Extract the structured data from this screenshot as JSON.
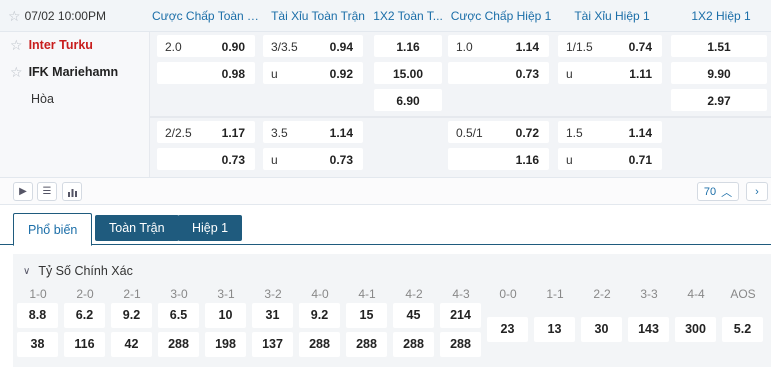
{
  "match": {
    "datetime": "07/02 10:00PM",
    "home": "Inter Turku",
    "away": "IFK Mariehamn",
    "draw": "Hòa"
  },
  "columns": [
    "Cược Chấp Toàn T...",
    "Tài Xỉu Toàn Trận",
    "1X2 Toàn T...",
    "Cược Chấp Hiệp 1",
    "Tài Xỉu Hiệp 1",
    "1X2 Hiệp 1"
  ],
  "odds": {
    "row1": {
      "ah_ft": {
        "line": "2.0",
        "home": "0.90",
        "away": "0.98"
      },
      "ou_ft": {
        "line": "3/3.5",
        "over": "0.94",
        "u": "u",
        "under": "0.92"
      },
      "x12_ft": {
        "home": "1.16",
        "away": "15.00",
        "draw": "6.90"
      },
      "ah_h1": {
        "line": "1.0",
        "home": "1.14",
        "away": "0.73"
      },
      "ou_h1": {
        "line": "1/1.5",
        "over": "0.74",
        "u": "u",
        "under": "1.11"
      },
      "x12_h1": {
        "home": "1.51",
        "away": "9.90",
        "draw": "2.97"
      }
    },
    "row2": {
      "ah_ft": {
        "line": "2/2.5",
        "home": "1.17",
        "away": "0.73"
      },
      "ou_ft": {
        "line": "3.5",
        "over": "1.14",
        "u": "u",
        "under": "0.73"
      },
      "ah_h1": {
        "line": "0.5/1",
        "home": "0.72",
        "away": "1.16"
      },
      "ou_h1": {
        "line": "1.5",
        "over": "1.14",
        "u": "u",
        "under": "0.71"
      }
    }
  },
  "toolbar": {
    "count": "70"
  },
  "tabs": {
    "popular": "Phổ biến",
    "full": "Toàn Trận",
    "half": "Hiệp 1"
  },
  "correct_score": {
    "title": "Tỷ Số Chính Xác",
    "home_scores": [
      "1-0",
      "2-0",
      "2-1",
      "3-0",
      "3-1",
      "3-2",
      "4-0",
      "4-1",
      "4-2",
      "4-3"
    ],
    "home_odds": [
      "8.8",
      "6.2",
      "9.2",
      "6.5",
      "10",
      "31",
      "9.2",
      "15",
      "45",
      "214"
    ],
    "away_odds": [
      "38",
      "116",
      "42",
      "288",
      "198",
      "137",
      "288",
      "288",
      "288",
      "288"
    ],
    "draw_scores": [
      "0-0",
      "1-1",
      "2-2",
      "3-3",
      "4-4",
      "AOS"
    ],
    "draw_odds": [
      "23",
      "13",
      "30",
      "143",
      "300",
      "5.2"
    ]
  }
}
